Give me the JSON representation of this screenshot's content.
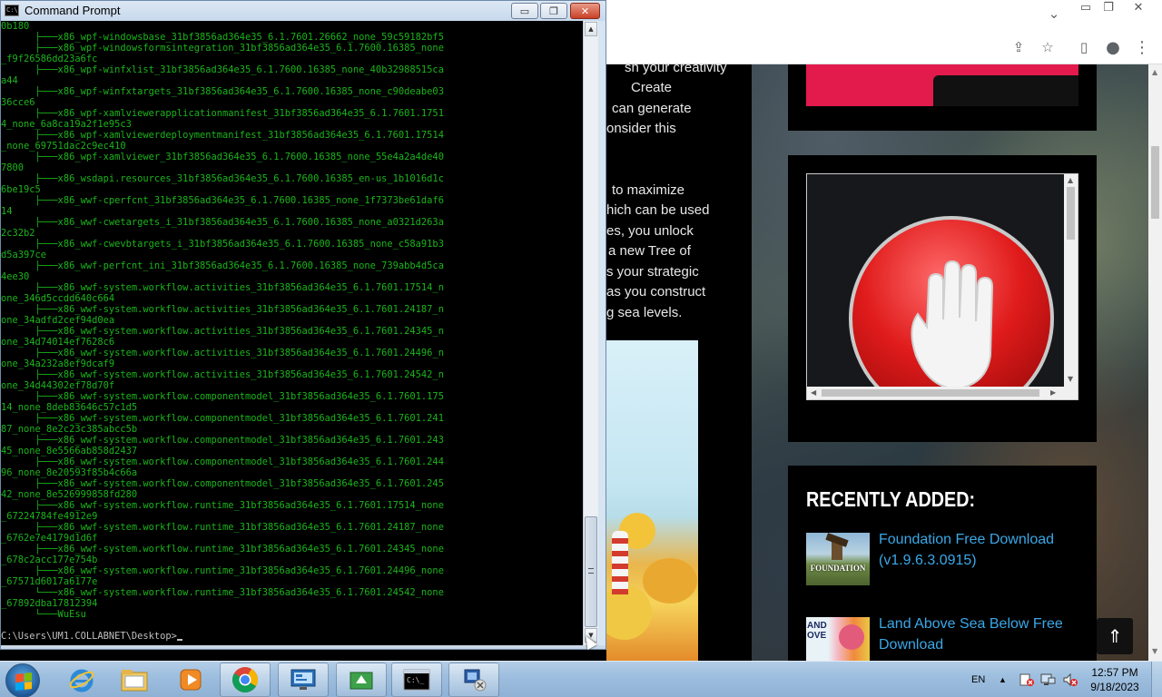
{
  "cmd": {
    "title": "Command Prompt",
    "minimize_glyph": "▭",
    "restore_glyph": "❐",
    "close_glyph": "✕",
    "lines": [
      "0b180",
      "      ├───x86_wpf-windowsbase_31bf3856ad364e35_6.1.7601.26662_none_59c59182bf5",
      "      ├───x86_wpf-windowsformsintegration_31bf3856ad364e35_6.1.7600.16385_none",
      "_f9f26586dd23a6fc",
      "      ├───x86_wpf-winfxlist_31bf3856ad364e35_6.1.7600.16385_none_40b32988515ca",
      "a44",
      "      ├───x86_wpf-winfxtargets_31bf3856ad364e35_6.1.7600.16385_none_c90deabe03",
      "36cce6",
      "      ├───x86_wpf-xamlviewerapplicationmanifest_31bf3856ad364e35_6.1.7601.1751",
      "4_none_6a8ca19a2f1e95c3",
      "      ├───x86_wpf-xamlviewerdeploymentmanifest_31bf3856ad364e35_6.1.7601.17514",
      "_none_69751dac2c9ec410",
      "      ├───x86_wpf-xamlviewer_31bf3856ad364e35_6.1.7600.16385_none_55e4a2a4de40",
      "7800",
      "      ├───x86_wsdapi.resources_31bf3856ad364e35_6.1.7600.16385_en-us_1b1016d1c",
      "6be19c5",
      "      ├───x86_wwf-cperfcnt_31bf3856ad364e35_6.1.7600.16385_none_1f7373be61daf6",
      "14",
      "      ├───x86_wwf-cwetargets_i_31bf3856ad364e35_6.1.7600.16385_none_a0321d263a",
      "2c32b2",
      "      ├───x86_wwf-cwevbtargets_i_31bf3856ad364e35_6.1.7600.16385_none_c58a91b3",
      "d5a397ce",
      "      ├───x86_wwf-perfcnt_ini_31bf3856ad364e35_6.1.7600.16385_none_739abb4d5ca",
      "4ee30",
      "      ├───x86_wwf-system.workflow.activities_31bf3856ad364e35_6.1.7601.17514_n",
      "one_346d5ccdd640c664",
      "      ├───x86_wwf-system.workflow.activities_31bf3856ad364e35_6.1.7601.24187_n",
      "one_34adfd2cef94d0ea",
      "      ├───x86_wwf-system.workflow.activities_31bf3856ad364e35_6.1.7601.24345_n",
      "one_34d74014ef7628c6",
      "      ├───x86_wwf-system.workflow.activities_31bf3856ad364e35_6.1.7601.24496_n",
      "one_34a232a8ef9dcaf9",
      "      ├───x86_wwf-system.workflow.activities_31bf3856ad364e35_6.1.7601.24542_n",
      "one_34d44302ef78d70f",
      "      ├───x86_wwf-system.workflow.componentmodel_31bf3856ad364e35_6.1.7601.175",
      "14_none_8deb83646c57c1d5",
      "      ├───x86_wwf-system.workflow.componentmodel_31bf3856ad364e35_6.1.7601.241",
      "87_none_8e2c23c385abcc5b",
      "      ├───x86_wwf-system.workflow.componentmodel_31bf3856ad364e35_6.1.7601.243",
      "45_none_8e5566ab858d2437",
      "      ├───x86_wwf-system.workflow.componentmodel_31bf3856ad364e35_6.1.7601.244",
      "96_none_8e20593f85b4c66a",
      "      ├───x86_wwf-system.workflow.componentmodel_31bf3856ad364e35_6.1.7601.245",
      "42_none_8e526999858fd280",
      "      ├───x86_wwf-system.workflow.runtime_31bf3856ad364e35_6.1.7601.17514_none",
      "_67224784fe4912e9",
      "      ├───x86_wwf-system.workflow.runtime_31bf3856ad364e35_6.1.7601.24187_none",
      "_6762e7e4179d1d6f",
      "      ├───x86_wwf-system.workflow.runtime_31bf3856ad364e35_6.1.7601.24345_none",
      "_678c2acc177e754b",
      "      ├───x86_wwf-system.workflow.runtime_31bf3856ad364e35_6.1.7601.24496_none",
      "_67571d6017a6177e",
      "      └───x86_wwf-system.workflow.runtime_31bf3856ad364e35_6.1.7601.24542_none",
      "_67892dba17812394",
      "      └───WuEsu",
      ""
    ],
    "prompt": "C:\\Users\\UM1.COLLABNET\\Desktop>"
  },
  "browser": {
    "share_icon": "⇪",
    "star_icon": "☆",
    "panel_icon": "▯",
    "profile_icon": "●",
    "menu_icon": "⋮",
    "chevron_icon": "⌄",
    "article_fragments": [
      "sh your creativity",
      "Create",
      "can generate",
      "onsider this",
      "to maximize",
      "hich can be used",
      "es, you unlock",
      "a new Tree of",
      "s your strategic",
      "as you construct",
      "g sea levels."
    ],
    "recent_title": "RECENTLY ADDED:",
    "recent_items": [
      {
        "title": "Foundation Free Download (v1.9.6.3.0915)",
        "thumb_text": "FOUNDATION"
      },
      {
        "title": "Land Above Sea Below Free Download",
        "thumb_text": "AND OVE"
      }
    ],
    "back_to_top": "⇑"
  },
  "taskbar": {
    "language": "EN",
    "time": "12:57 PM",
    "date": "9/18/2023",
    "apps": [
      "Internet Explorer",
      "Windows Explorer",
      "Media Player",
      "Google Chrome",
      "Remote Desktop",
      "File Transfer",
      "Command Prompt",
      "Network"
    ]
  },
  "colors": {
    "console_text": "#1bb41b",
    "link": "#3aa8e8",
    "ad_red": "#e31b4c"
  }
}
